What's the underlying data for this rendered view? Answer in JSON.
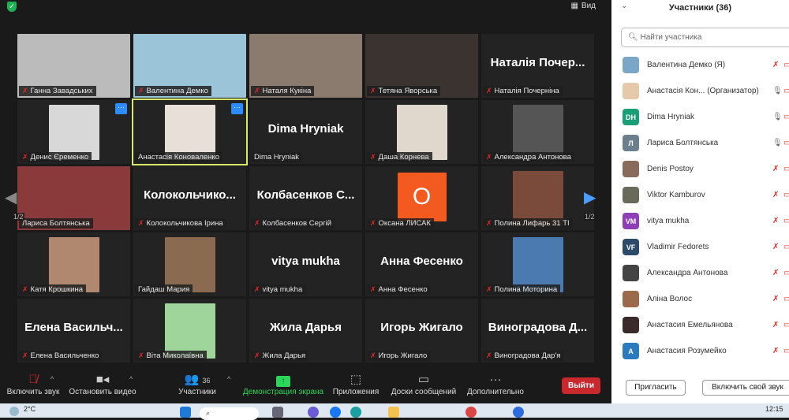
{
  "topbar": {
    "view_label": "Вид"
  },
  "grid": {
    "page_left": "1/2",
    "page_right": "1/2",
    "tiles": [
      {
        "name": "Ганна Завадських",
        "muted": true,
        "photo": "#bbb",
        "full": true
      },
      {
        "name": "Валентина Демко",
        "muted": true,
        "photo": "#9cc4d8",
        "full": true
      },
      {
        "name": "Наталя Кукіна",
        "muted": true,
        "photo": "#8a7b6e",
        "full": true
      },
      {
        "name": "Тетяна Яворська",
        "muted": true,
        "photo": "#3a3330",
        "full": true
      },
      {
        "name": "Наталія Почерніна",
        "muted": true,
        "big": "Наталія Почер..."
      },
      {
        "name": "Денис Єременко",
        "muted": true,
        "photo": "#d8d8d8",
        "more": true
      },
      {
        "name": "Анастасія Коноваленко",
        "muted": false,
        "photo": "#e8e0d8",
        "more": true,
        "active": true
      },
      {
        "name": "Dima Hryniak",
        "muted": false,
        "big": "Dima Hryniak"
      },
      {
        "name": "Даша Корнева",
        "muted": true,
        "photo": "#e0d8cc"
      },
      {
        "name": "Александра Антонова",
        "muted": true,
        "photo": "#555"
      },
      {
        "name": "Лариса Болтянська",
        "muted": false,
        "photo": "#8a3a3a",
        "full": true
      },
      {
        "name": "Колокольчикова Ірина",
        "muted": true,
        "big": "Колокольчико..."
      },
      {
        "name": "Колбасенков Сергій",
        "muted": true,
        "big": "Колбасенков С..."
      },
      {
        "name": "Оксана ЛИСАК",
        "muted": true,
        "avatar": "О"
      },
      {
        "name": "Полина Лифарь 31 ТІ",
        "muted": true,
        "photo": "#7a4a3a"
      },
      {
        "name": "Катя Крошкина",
        "muted": true,
        "photo": "#b08870"
      },
      {
        "name": "Гайдаш Мария",
        "muted": false,
        "photo": "#8a6a50"
      },
      {
        "name": "vitya mukha",
        "muted": true,
        "big": "vitya mukha"
      },
      {
        "name": "Анна Фесенко",
        "muted": true,
        "big": "Анна Фесенко"
      },
      {
        "name": "Полина Моторина",
        "muted": true,
        "photo": "#4a7ab0"
      },
      {
        "name": "Елена Васильченко",
        "muted": true,
        "big": "Елена Васильч..."
      },
      {
        "name": "Віта Миколаївна",
        "muted": true,
        "photo": "#9fd49a"
      },
      {
        "name": "Жила Дарья",
        "muted": true,
        "big": "Жила Дарья"
      },
      {
        "name": "Игорь Жигало",
        "muted": true,
        "big": "Игорь Жигало"
      },
      {
        "name": "Виноградова Дар'я",
        "muted": true,
        "big": "Виноградова Д..."
      }
    ]
  },
  "toolbar": {
    "unmute": "Включить звук",
    "stop_video": "Остановить видео",
    "participants": "Участники",
    "participants_count": "36",
    "share": "Демонстрация экрана",
    "apps": "Приложения",
    "whiteboards": "Доски сообщений",
    "more": "Дополнительно",
    "leave": "Выйти"
  },
  "panel": {
    "title": "Участники (36)",
    "search_placeholder": "Найти участника",
    "invite": "Пригласить",
    "unmute_me": "Включить свой звук",
    "participants": [
      {
        "name": "Валентина Демко (Я)",
        "initials": "",
        "color": "#7aa6c8",
        "mic": "muted"
      },
      {
        "name": "Анастасія Кон...  (Организатор)",
        "initials": "",
        "color": "#e6c9a8",
        "mic": "on"
      },
      {
        "name": "Dima Hryniak",
        "initials": "DH",
        "color": "#1a9e75",
        "mic": "on"
      },
      {
        "name": "Лариса Болтянська",
        "initials": "Л",
        "color": "#6b7f8e",
        "mic": "on"
      },
      {
        "name": "Denis Postoy",
        "initials": "",
        "color": "#8a6a5a",
        "mic": "muted"
      },
      {
        "name": "Viktor Kamburov",
        "initials": "",
        "color": "#6a6a5a",
        "mic": "muted"
      },
      {
        "name": "vitya mukha",
        "initials": "VM",
        "color": "#8e3fb5",
        "mic": "muted"
      },
      {
        "name": "Vladimir Fedorets",
        "initials": "VF",
        "color": "#2c4a6a",
        "mic": "muted"
      },
      {
        "name": "Александра Антонова",
        "initials": "",
        "color": "#444",
        "mic": "muted"
      },
      {
        "name": "Аліна Волос",
        "initials": "",
        "color": "#9a6a4a",
        "mic": "muted"
      },
      {
        "name": "Анастасия Емельянова",
        "initials": "",
        "color": "#3a2a2a",
        "mic": "muted"
      },
      {
        "name": "Анастасия Розумейко",
        "initials": "A",
        "color": "#2a7ac0",
        "mic": "muted"
      }
    ]
  },
  "taskbar": {
    "weather": "2°C",
    "clock": "12:15"
  }
}
